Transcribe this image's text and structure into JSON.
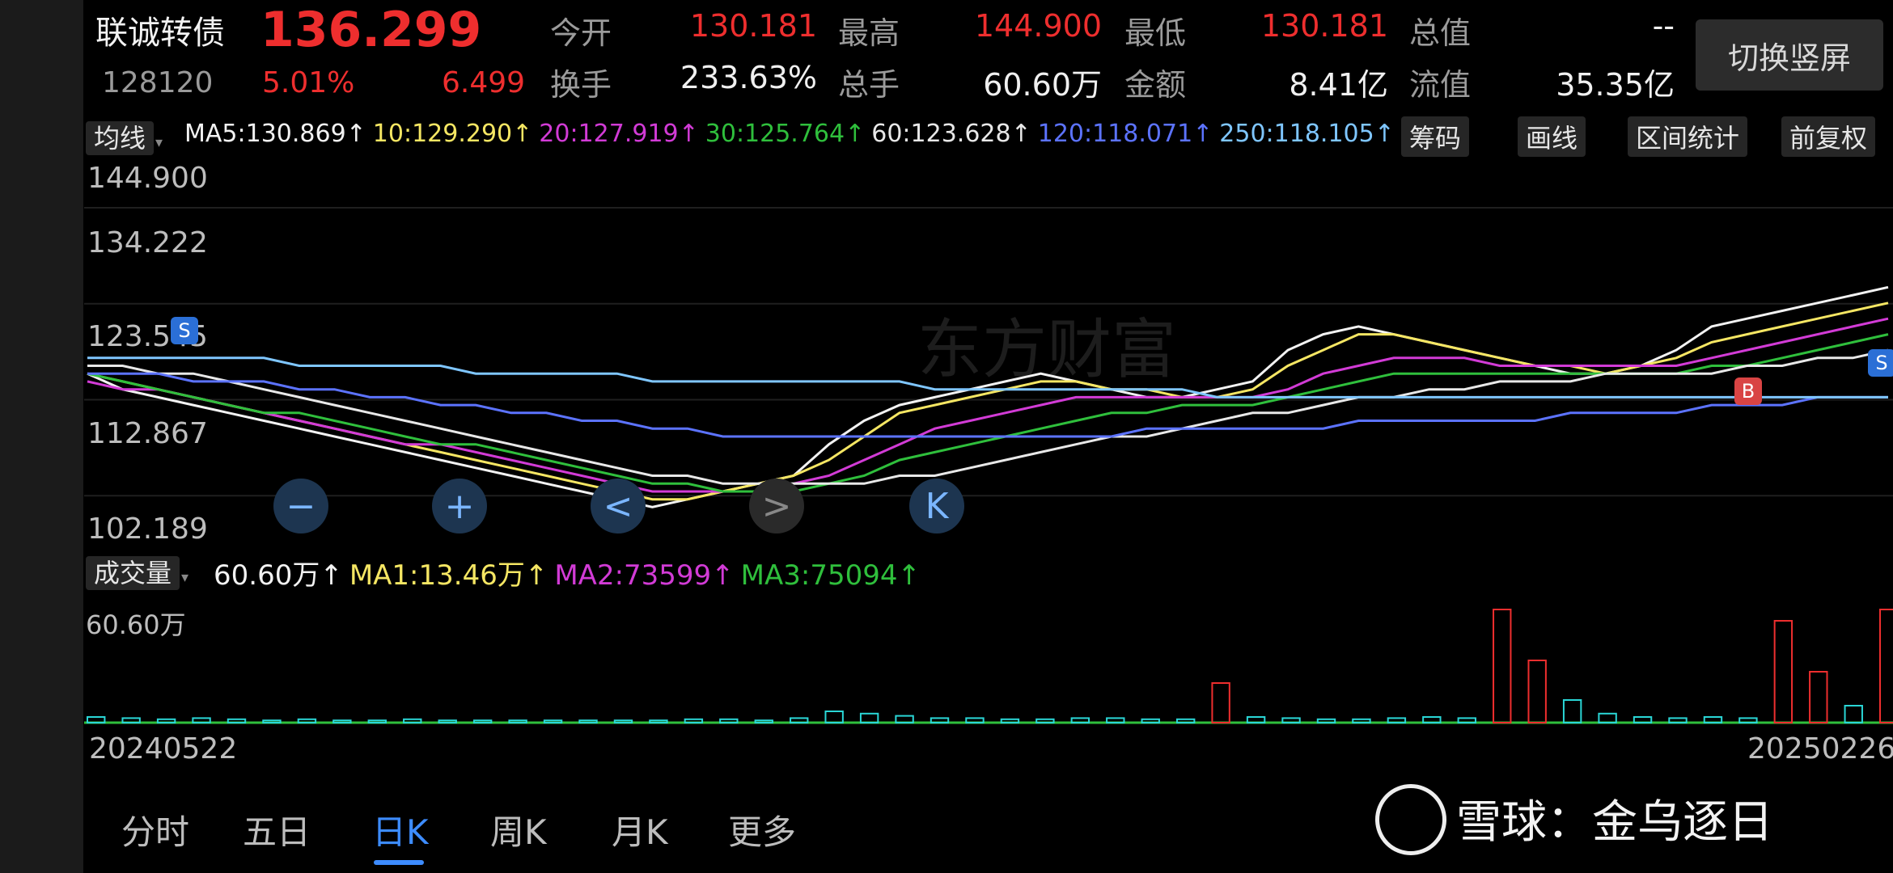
{
  "header": {
    "name": "联诚转债",
    "price": "136.299",
    "code": "128120",
    "change_pct": "5.01%",
    "change_abs": "6.499",
    "stats": [
      {
        "label": "今开",
        "value": "130.181",
        "color": "red"
      },
      {
        "label": "最高",
        "value": "144.900",
        "color": "red"
      },
      {
        "label": "最低",
        "value": "130.181",
        "color": "red"
      },
      {
        "label": "总值",
        "value": "--",
        "color": "white"
      },
      {
        "label": "换手",
        "value": "233.63%",
        "color": "white"
      },
      {
        "label": "总手",
        "value": "60.60万",
        "color": "white"
      },
      {
        "label": "金额",
        "value": "8.41亿",
        "color": "white"
      },
      {
        "label": "流值",
        "value": "35.35亿",
        "color": "white"
      }
    ],
    "switch_button": "切换竖屏"
  },
  "ma_bar": {
    "selector": "均线",
    "items": [
      {
        "text": "MA5:130.869↑",
        "color": "#f2f2f2"
      },
      {
        "text": "10:129.290↑",
        "color": "#f5e663"
      },
      {
        "text": "20:127.919↑",
        "color": "#d23bd6"
      },
      {
        "text": "30:125.764↑",
        "color": "#2fbf3c"
      },
      {
        "text": "60:123.628↑",
        "color": "#e8e8e8"
      },
      {
        "text": "120:118.071↑",
        "color": "#5c73ff"
      },
      {
        "text": "250:118.105↑",
        "color": "#7fc6ff"
      }
    ],
    "buttons": [
      "筹码",
      "画线",
      "区间统计",
      "前复权"
    ]
  },
  "price_axis": [
    "144.900",
    "134.222",
    "123.545",
    "112.867",
    "102.189"
  ],
  "volume_bar": {
    "selector": "成交量",
    "items": [
      {
        "text": "60.60万↑",
        "color": "#f2f2f2"
      },
      {
        "text": "MA1:13.46万↑",
        "color": "#f5e663"
      },
      {
        "text": "MA2:73599↑",
        "color": "#d23bd6"
      },
      {
        "text": "MA3:75094↑",
        "color": "#2fbf3c"
      }
    ],
    "axis_top": "60.60万"
  },
  "dates": {
    "start": "20240522",
    "end": "20250226"
  },
  "markers": {
    "sell": "S",
    "buy": "B"
  },
  "zoom_controls": [
    "−",
    "+",
    "<",
    ">",
    "K"
  ],
  "watermark_bg": "东方财富",
  "bottom_nav": [
    "分时",
    "五日",
    "日K",
    "周K",
    "月K",
    "更多"
  ],
  "active_tab": "日K",
  "xueqiu_watermark": "雪球：金乌逐日",
  "chart_data": {
    "type": "line",
    "title": "",
    "ylim": [
      102.189,
      144.9
    ],
    "series": [
      {
        "name": "MA5",
        "color": "#f2f2f2",
        "values": [
          121,
          119,
          118,
          117,
          116,
          115,
          114,
          113,
          112,
          111,
          110,
          109,
          108,
          107,
          106,
          105,
          104,
          105,
          106,
          107,
          108,
          112,
          115,
          117,
          118,
          119,
          120,
          121,
          120,
          119,
          118,
          118,
          119,
          120,
          124,
          126,
          127,
          126,
          125,
          124,
          123,
          122,
          121,
          121,
          122,
          124,
          127,
          128,
          129,
          130,
          131,
          132
        ]
      },
      {
        "name": "MA10",
        "color": "#f5e663",
        "values": [
          121,
          120,
          119,
          118,
          117,
          116,
          115,
          114,
          113,
          112,
          111,
          110,
          109,
          108,
          107,
          106,
          105,
          105,
          106,
          107,
          108,
          110,
          113,
          116,
          117,
          118,
          119,
          120,
          120,
          119,
          119,
          118,
          118,
          119,
          122,
          124,
          126,
          126,
          125,
          124,
          123,
          122,
          122,
          121,
          122,
          123,
          125,
          126,
          127,
          128,
          129,
          130
        ]
      },
      {
        "name": "MA20",
        "color": "#d23bd6",
        "values": [
          120,
          119,
          119,
          118,
          117,
          116,
          115,
          114,
          113,
          112,
          112,
          111,
          110,
          109,
          108,
          107,
          106,
          106,
          106,
          106,
          107,
          108,
          110,
          112,
          114,
          115,
          116,
          117,
          118,
          118,
          118,
          118,
          118,
          118,
          119,
          121,
          122,
          123,
          123,
          123,
          122,
          122,
          122,
          122,
          122,
          122,
          123,
          124,
          125,
          126,
          127,
          128
        ]
      },
      {
        "name": "MA30",
        "color": "#2fbf3c",
        "values": [
          121,
          120,
          119,
          118,
          117,
          116,
          116,
          115,
          114,
          113,
          112,
          112,
          111,
          110,
          109,
          108,
          107,
          107,
          106,
          106,
          106,
          107,
          108,
          110,
          111,
          112,
          113,
          114,
          115,
          116,
          116,
          117,
          117,
          117,
          118,
          119,
          120,
          121,
          121,
          121,
          121,
          121,
          121,
          121,
          121,
          121,
          122,
          122,
          123,
          124,
          125,
          126
        ]
      },
      {
        "name": "MA60",
        "color": "#e8e8e8",
        "values": [
          122,
          122,
          121,
          121,
          120,
          119,
          118,
          117,
          116,
          115,
          114,
          113,
          112,
          111,
          110,
          109,
          108,
          108,
          107,
          107,
          107,
          107,
          107,
          108,
          108,
          109,
          110,
          111,
          112,
          113,
          113,
          114,
          115,
          116,
          116,
          117,
          118,
          118,
          119,
          119,
          120,
          120,
          120,
          121,
          121,
          121,
          121,
          122,
          122,
          123,
          123,
          124
        ]
      },
      {
        "name": "MA120",
        "color": "#5c73ff",
        "values": [
          121,
          121,
          121,
          120,
          120,
          120,
          119,
          119,
          118,
          118,
          117,
          117,
          116,
          116,
          115,
          115,
          114,
          114,
          113,
          113,
          113,
          113,
          113,
          113,
          113,
          113,
          113,
          113,
          113,
          113,
          114,
          114,
          114,
          114,
          114,
          114,
          115,
          115,
          115,
          115,
          115,
          115,
          116,
          116,
          116,
          116,
          117,
          117,
          117,
          118,
          118,
          118
        ]
      },
      {
        "name": "MA250",
        "color": "#7fc6ff",
        "values": [
          123,
          123,
          123,
          123,
          123,
          123,
          122,
          122,
          122,
          122,
          122,
          121,
          121,
          121,
          121,
          121,
          120,
          120,
          120,
          120,
          120,
          120,
          120,
          120,
          119,
          119,
          119,
          119,
          119,
          119,
          119,
          119,
          118,
          118,
          118,
          118,
          118,
          118,
          118,
          118,
          118,
          118,
          118,
          118,
          118,
          118,
          118,
          118,
          118,
          118,
          118,
          118
        ]
      }
    ],
    "volume": [
      0.05,
      0.04,
      0.03,
      0.04,
      0.03,
      0.02,
      0.03,
      0.02,
      0.02,
      0.03,
      0.02,
      0.02,
      0.02,
      0.02,
      0.02,
      0.02,
      0.02,
      0.03,
      0.03,
      0.02,
      0.04,
      0.1,
      0.08,
      0.06,
      0.04,
      0.04,
      0.03,
      0.03,
      0.04,
      0.04,
      0.03,
      0.03,
      0.35,
      0.05,
      0.04,
      0.03,
      0.03,
      0.04,
      0.05,
      0.04,
      1.0,
      0.55,
      0.2,
      0.08,
      0.05,
      0.04,
      0.05,
      0.04,
      0.9,
      0.45,
      0.15,
      1.0
    ]
  }
}
